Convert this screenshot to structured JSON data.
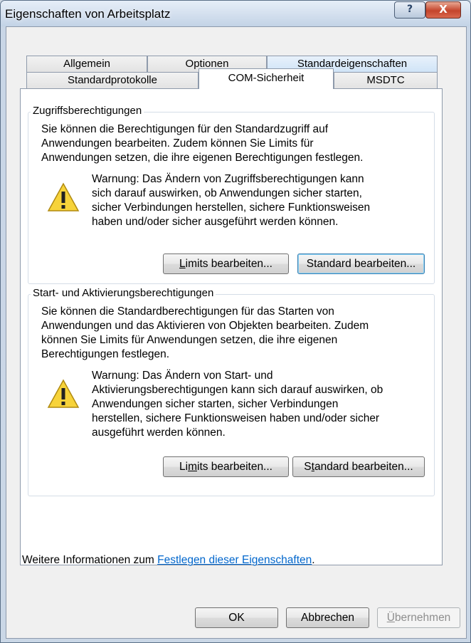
{
  "window": {
    "title": "Eigenschaften von Arbeitsplatz",
    "help_icon": "?",
    "close_icon": "X"
  },
  "tabs": {
    "row1": [
      "Allgemein",
      "Optionen",
      "Standardeigenschaften"
    ],
    "row2": [
      "Standardprotokolle",
      "COM-Sicherheit",
      "MSDTC"
    ],
    "active": "COM-Sicherheit"
  },
  "access": {
    "group_label": "Zugriffsberechtigungen",
    "description": "Sie können die Berechtigungen für den Standardzugriff auf\nAnwendungen bearbeiten. Zudem können Sie Limits für\nAnwendungen setzen, die ihre eigenen Berechtigungen festlegen.",
    "warning": "Warnung: Das Ändern von Zugriffsberechtigungen kann\nsich darauf auswirken, ob Anwendungen sicher starten,\nsicher Verbindungen herstellen, sichere Funktionsweisen\nhaben und/oder sicher ausgeführt werden können.",
    "limits_button": {
      "pre": "",
      "accel": "L",
      "post": "imits bearbeiten..."
    },
    "default_button": "Standard bearbeiten..."
  },
  "launch": {
    "group_label": "Start- und Aktivierungsberechtigungen",
    "description": "Sie können die Standardberechtigungen für das Starten von\nAnwendungen und das Aktivieren von Objekten bearbeiten. Zudem\nkönnen Sie Limits für Anwendungen setzen, die ihre eigenen\nBerechtigungen festlegen.",
    "warning": "Warnung: Das Ändern von Start- und\nAktivierungsberechtigungen kann sich darauf auswirken, ob\nAnwendungen sicher starten, sicher Verbindungen\nherstellen, sichere Funktionsweisen haben und/oder sicher\nausgeführt werden können.",
    "limits_button": {
      "pre": "Li",
      "accel": "m",
      "post": "its bearbeiten..."
    },
    "default_button": {
      "pre": "S",
      "accel": "t",
      "post": "andard bearbeiten..."
    }
  },
  "footer": {
    "text": "Weitere Informationen zum ",
    "link": "Festlegen dieser Eigenschaften",
    "suffix": "."
  },
  "buttons": {
    "ok": "OK",
    "cancel": "Abbrechen",
    "apply": {
      "accel": "Ü",
      "post": "bernehmen"
    }
  },
  "colors": {
    "link": "#0066cc",
    "warning_yellow": "#f7d33a"
  }
}
